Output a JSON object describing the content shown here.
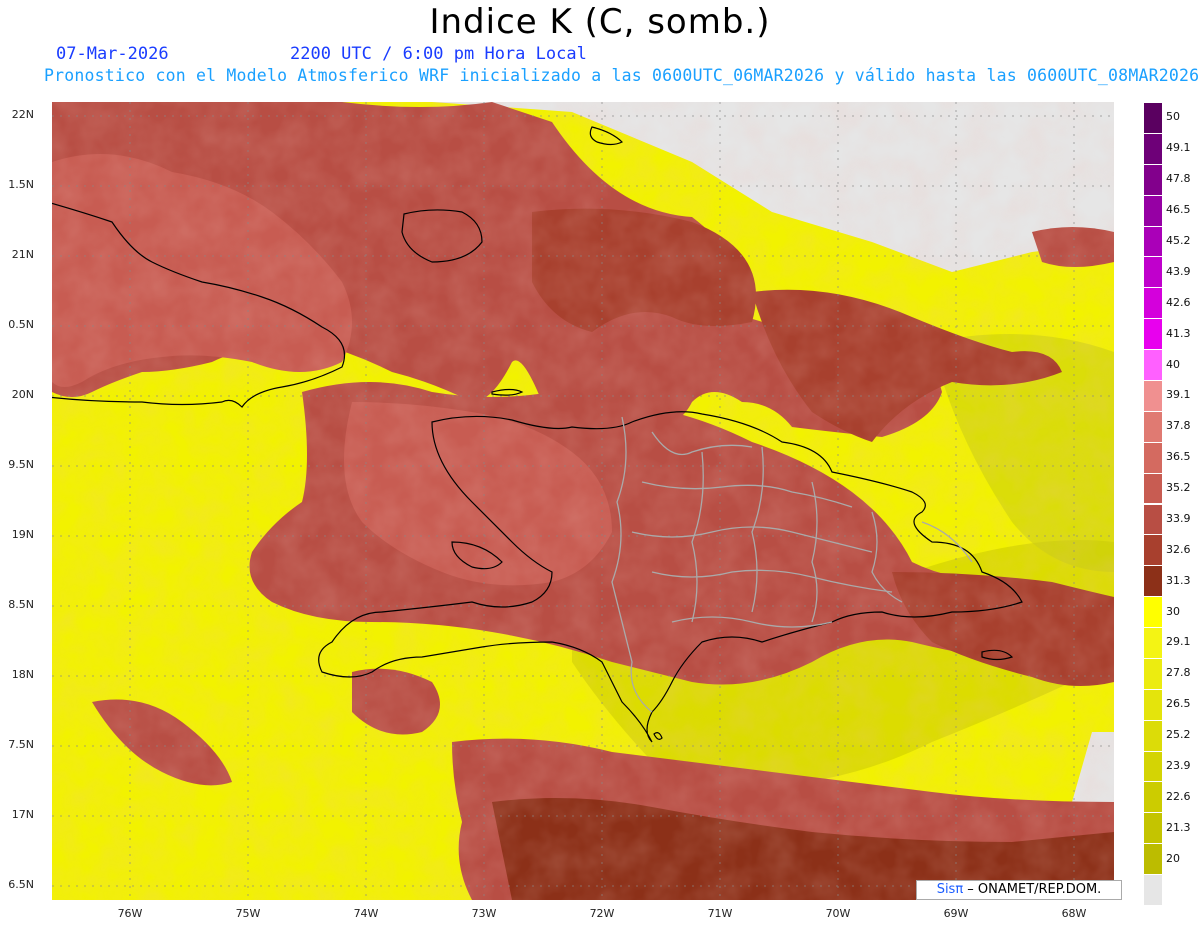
{
  "title": "Indice K (C, somb.)",
  "date": "07-Mar-2026",
  "time": "2200 UTC / 6:00 pm Hora Local",
  "subtitle": "Pronostico con el Modelo Atmosferico WRF inicializado a las 0600UTC_06MAR2026 y válido hasta las  0600UTC_08MAR2026",
  "credit": {
    "brand": "Sisπ",
    "org": " – ONAMET/REP.DOM."
  },
  "lat_labels": [
    "22N",
    "1.5N",
    "21N",
    "0.5N",
    "20N",
    "9.5N",
    "19N",
    "8.5N",
    "18N",
    "7.5N",
    "17N",
    "6.5N"
  ],
  "lon_labels": [
    "76W",
    "75W",
    "74W",
    "73W",
    "72W",
    "71W",
    "70W",
    "69W",
    "68W"
  ],
  "colorbar": [
    {
      "label": "50",
      "color": "#5a0060"
    },
    {
      "label": "49.1",
      "color": "#6e0078"
    },
    {
      "label": "47.8",
      "color": "#82008c"
    },
    {
      "label": "46.5",
      "color": "#9600a4"
    },
    {
      "label": "45.2",
      "color": "#aa00b8"
    },
    {
      "label": "43.9",
      "color": "#c000cc"
    },
    {
      "label": "42.6",
      "color": "#d400dc"
    },
    {
      "label": "41.3",
      "color": "#e800ee"
    },
    {
      "label": "40",
      "color": "#ff60ff"
    },
    {
      "label": "39.1",
      "color": "#f09090"
    },
    {
      "label": "37.8",
      "color": "#e07a72"
    },
    {
      "label": "36.5",
      "color": "#d46a60"
    },
    {
      "label": "35.2",
      "color": "#c85c52"
    },
    {
      "label": "33.9",
      "color": "#b84e44"
    },
    {
      "label": "32.6",
      "color": "#a8402e"
    },
    {
      "label": "31.3",
      "color": "#8c3018"
    },
    {
      "label": "30",
      "color": "#ffff00"
    },
    {
      "label": "29.1",
      "color": "#f4f414"
    },
    {
      "label": "27.8",
      "color": "#ecec10"
    },
    {
      "label": "26.5",
      "color": "#e4e40c"
    },
    {
      "label": "25.2",
      "color": "#dcdc08"
    },
    {
      "label": "23.9",
      "color": "#d4d404"
    },
    {
      "label": "22.6",
      "color": "#cccc00"
    },
    {
      "label": "21.3",
      "color": "#c4c400"
    },
    {
      "label": "20",
      "color": "#bcbc00"
    },
    {
      "label": "",
      "color": "#e6e6e6"
    }
  ]
}
